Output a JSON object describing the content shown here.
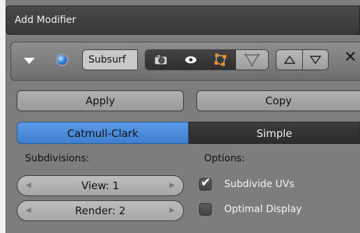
{
  "add_modifier": {
    "label": "Add Modifier"
  },
  "modifier": {
    "name": "Subsurf",
    "icons": {
      "expand": "triangle-down-icon",
      "type": "sphere-icon",
      "render": "camera-icon",
      "viewport": "eye-icon",
      "edit_mode": "edit-mode-icon",
      "cage": "cage-icon",
      "move_up": "triangle-up-icon",
      "move_down": "triangle-down-icon",
      "remove": "close-icon"
    },
    "apply_label": "Apply",
    "copy_label": "Copy",
    "algorithm": {
      "options": [
        "Catmull-Clark",
        "Simple"
      ],
      "selected": "Catmull-Clark"
    },
    "subdivisions_label": "Subdivisions:",
    "view_label": "View: 1",
    "render_label": "Render: 2",
    "options_label": "Options:",
    "subdivide_uvs": {
      "label": "Subdivide UVs",
      "checked": true
    },
    "optimal_display": {
      "label": "Optimal Display",
      "checked": false
    }
  },
  "colors": {
    "panel_bg": "#7d7d7d",
    "accent": "#4a8ade",
    "dark_button": "#333333"
  }
}
